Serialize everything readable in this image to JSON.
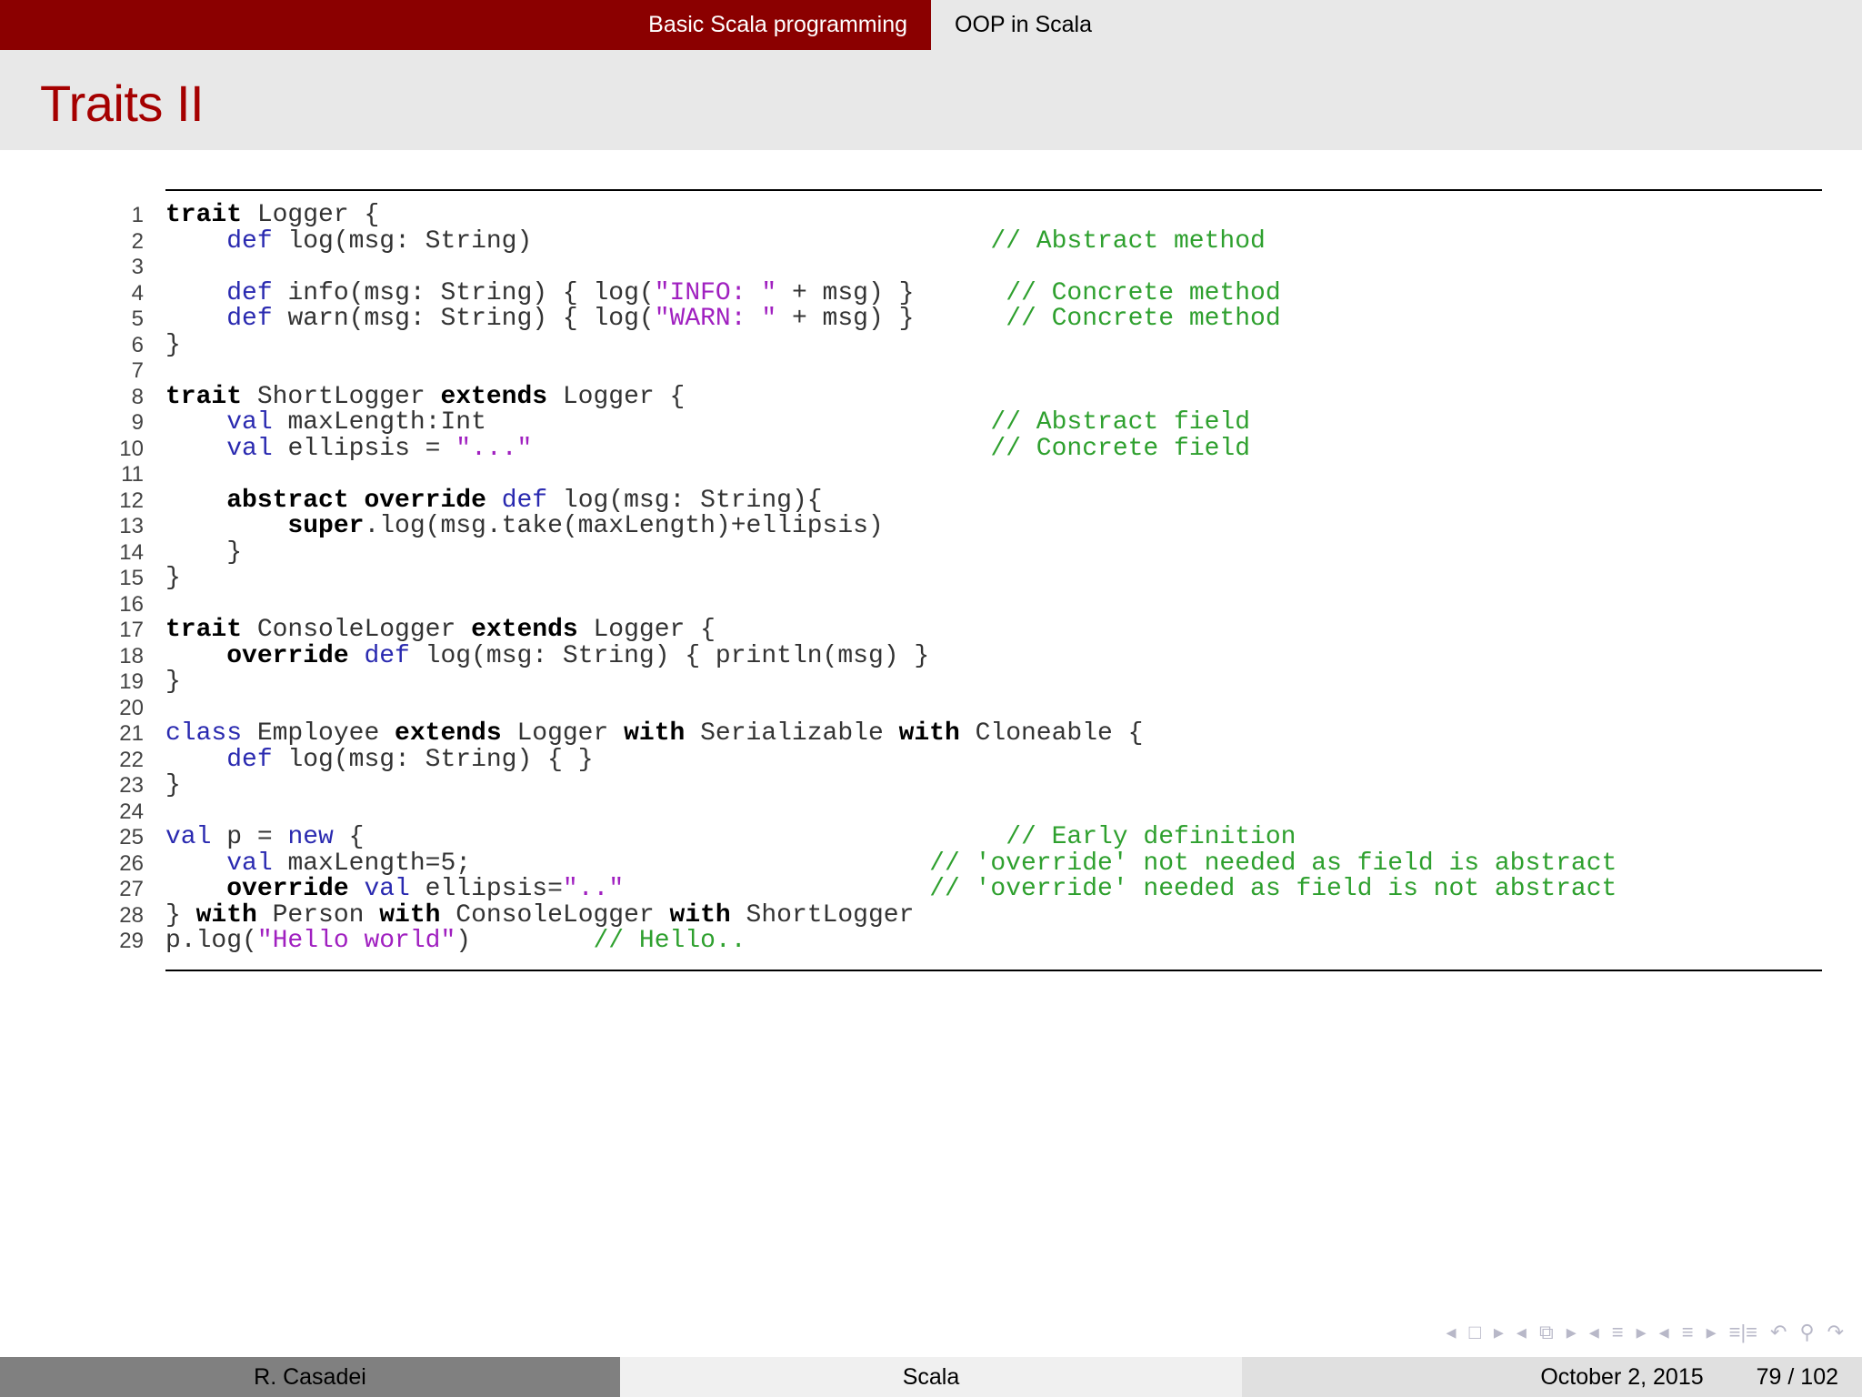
{
  "nav": {
    "section_active": "Basic Scala programming",
    "section_other": "OOP in Scala"
  },
  "slide": {
    "title": "Traits II"
  },
  "code": [
    {
      "n": "1",
      "t": [
        {
          "c": "kw",
          "s": "trait"
        },
        {
          "c": "",
          "s": " Logger {"
        }
      ]
    },
    {
      "n": "2",
      "t": [
        {
          "c": "",
          "s": "    "
        },
        {
          "c": "kb",
          "s": "def"
        },
        {
          "c": "",
          "s": " log(msg: String)                              "
        },
        {
          "c": "cm",
          "s": "// Abstract method"
        }
      ]
    },
    {
      "n": "3",
      "t": []
    },
    {
      "n": "4",
      "t": [
        {
          "c": "",
          "s": "    "
        },
        {
          "c": "kb",
          "s": "def"
        },
        {
          "c": "",
          "s": " info(msg: String) { log("
        },
        {
          "c": "st",
          "s": "\"INFO: \""
        },
        {
          "c": "",
          "s": " + msg) }      "
        },
        {
          "c": "cm",
          "s": "// Concrete method"
        }
      ]
    },
    {
      "n": "5",
      "t": [
        {
          "c": "",
          "s": "    "
        },
        {
          "c": "kb",
          "s": "def"
        },
        {
          "c": "",
          "s": " warn(msg: String) { log("
        },
        {
          "c": "st",
          "s": "\"WARN: \""
        },
        {
          "c": "",
          "s": " + msg) }      "
        },
        {
          "c": "cm",
          "s": "// Concrete method"
        }
      ]
    },
    {
      "n": "6",
      "t": [
        {
          "c": "",
          "s": "}"
        }
      ]
    },
    {
      "n": "7",
      "t": []
    },
    {
      "n": "8",
      "t": [
        {
          "c": "kw",
          "s": "trait"
        },
        {
          "c": "",
          "s": " ShortLogger "
        },
        {
          "c": "kw",
          "s": "extends"
        },
        {
          "c": "",
          "s": " Logger {"
        }
      ]
    },
    {
      "n": "9",
      "t": [
        {
          "c": "",
          "s": "    "
        },
        {
          "c": "kb",
          "s": "val"
        },
        {
          "c": "",
          "s": " maxLength:Int                                 "
        },
        {
          "c": "cm",
          "s": "// Abstract field"
        }
      ]
    },
    {
      "n": "10",
      "t": [
        {
          "c": "",
          "s": "    "
        },
        {
          "c": "kb",
          "s": "val"
        },
        {
          "c": "",
          "s": " ellipsis = "
        },
        {
          "c": "st",
          "s": "\"...\""
        },
        {
          "c": "",
          "s": "                              "
        },
        {
          "c": "cm",
          "s": "// Concrete field"
        }
      ]
    },
    {
      "n": "11",
      "t": []
    },
    {
      "n": "12",
      "t": [
        {
          "c": "",
          "s": "    "
        },
        {
          "c": "kw",
          "s": "abstract"
        },
        {
          "c": "",
          "s": " "
        },
        {
          "c": "kw",
          "s": "override"
        },
        {
          "c": "",
          "s": " "
        },
        {
          "c": "kb",
          "s": "def"
        },
        {
          "c": "",
          "s": " log(msg: String){"
        }
      ]
    },
    {
      "n": "13",
      "t": [
        {
          "c": "",
          "s": "        "
        },
        {
          "c": "kw",
          "s": "super"
        },
        {
          "c": "",
          "s": ".log(msg.take(maxLength)+ellipsis)"
        }
      ]
    },
    {
      "n": "14",
      "t": [
        {
          "c": "",
          "s": "    }"
        }
      ]
    },
    {
      "n": "15",
      "t": [
        {
          "c": "",
          "s": "}"
        }
      ]
    },
    {
      "n": "16",
      "t": []
    },
    {
      "n": "17",
      "t": [
        {
          "c": "kw",
          "s": "trait"
        },
        {
          "c": "",
          "s": " ConsoleLogger "
        },
        {
          "c": "kw",
          "s": "extends"
        },
        {
          "c": "",
          "s": " Logger {"
        }
      ]
    },
    {
      "n": "18",
      "t": [
        {
          "c": "",
          "s": "    "
        },
        {
          "c": "kw",
          "s": "override"
        },
        {
          "c": "",
          "s": " "
        },
        {
          "c": "kb",
          "s": "def"
        },
        {
          "c": "",
          "s": " log(msg: String) { println(msg) }"
        }
      ]
    },
    {
      "n": "19",
      "t": [
        {
          "c": "",
          "s": "}"
        }
      ]
    },
    {
      "n": "20",
      "t": []
    },
    {
      "n": "21",
      "t": [
        {
          "c": "kb",
          "s": "class"
        },
        {
          "c": "",
          "s": " Employee "
        },
        {
          "c": "kw",
          "s": "extends"
        },
        {
          "c": "",
          "s": " Logger "
        },
        {
          "c": "kw",
          "s": "with"
        },
        {
          "c": "",
          "s": " Serializable "
        },
        {
          "c": "kw",
          "s": "with"
        },
        {
          "c": "",
          "s": " Cloneable {"
        }
      ]
    },
    {
      "n": "22",
      "t": [
        {
          "c": "",
          "s": "    "
        },
        {
          "c": "kb",
          "s": "def"
        },
        {
          "c": "",
          "s": " log(msg: String) { }"
        }
      ]
    },
    {
      "n": "23",
      "t": [
        {
          "c": "",
          "s": "}"
        }
      ]
    },
    {
      "n": "24",
      "t": []
    },
    {
      "n": "25",
      "t": [
        {
          "c": "kb",
          "s": "val"
        },
        {
          "c": "",
          "s": " p = "
        },
        {
          "c": "kb",
          "s": "new"
        },
        {
          "c": "",
          "s": " {                                          "
        },
        {
          "c": "cm",
          "s": "// Early definition"
        }
      ]
    },
    {
      "n": "26",
      "t": [
        {
          "c": "",
          "s": "    "
        },
        {
          "c": "kb",
          "s": "val"
        },
        {
          "c": "",
          "s": " maxLength=5;                              "
        },
        {
          "c": "cm",
          "s": "// 'override' not needed as field is abstract"
        }
      ]
    },
    {
      "n": "27",
      "t": [
        {
          "c": "",
          "s": "    "
        },
        {
          "c": "kw",
          "s": "override"
        },
        {
          "c": "",
          "s": " "
        },
        {
          "c": "kb",
          "s": "val"
        },
        {
          "c": "",
          "s": " ellipsis="
        },
        {
          "c": "st",
          "s": "\"..\""
        },
        {
          "c": "",
          "s": "                    "
        },
        {
          "c": "cm",
          "s": "// 'override' needed as field is not abstract"
        }
      ]
    },
    {
      "n": "28",
      "t": [
        {
          "c": "",
          "s": "} "
        },
        {
          "c": "kw",
          "s": "with"
        },
        {
          "c": "",
          "s": " Person "
        },
        {
          "c": "kw",
          "s": "with"
        },
        {
          "c": "",
          "s": " ConsoleLogger "
        },
        {
          "c": "kw",
          "s": "with"
        },
        {
          "c": "",
          "s": " ShortLogger"
        }
      ]
    },
    {
      "n": "29",
      "t": [
        {
          "c": "",
          "s": "p.log("
        },
        {
          "c": "st",
          "s": "\"Hello world\""
        },
        {
          "c": "",
          "s": ")        "
        },
        {
          "c": "cm",
          "s": "// Hello.."
        }
      ]
    }
  ],
  "footer": {
    "author": "R. Casadei",
    "short_title": "Scala",
    "date": "October 2, 2015",
    "page": "79 / 102"
  },
  "icons": [
    "nav-left-arrow-icon",
    "frame-icon",
    "nav-right-arrow-icon",
    "nav-left-arrow-icon",
    "subsection-icon",
    "nav-right-arrow-icon",
    "nav-left-arrow-icon",
    "section-icon",
    "nav-right-arrow-icon",
    "nav-left-arrow-icon",
    "section-icon",
    "nav-right-arrow-icon",
    "toc-icon",
    "undo-icon",
    "search-icon",
    "redo-icon"
  ]
}
